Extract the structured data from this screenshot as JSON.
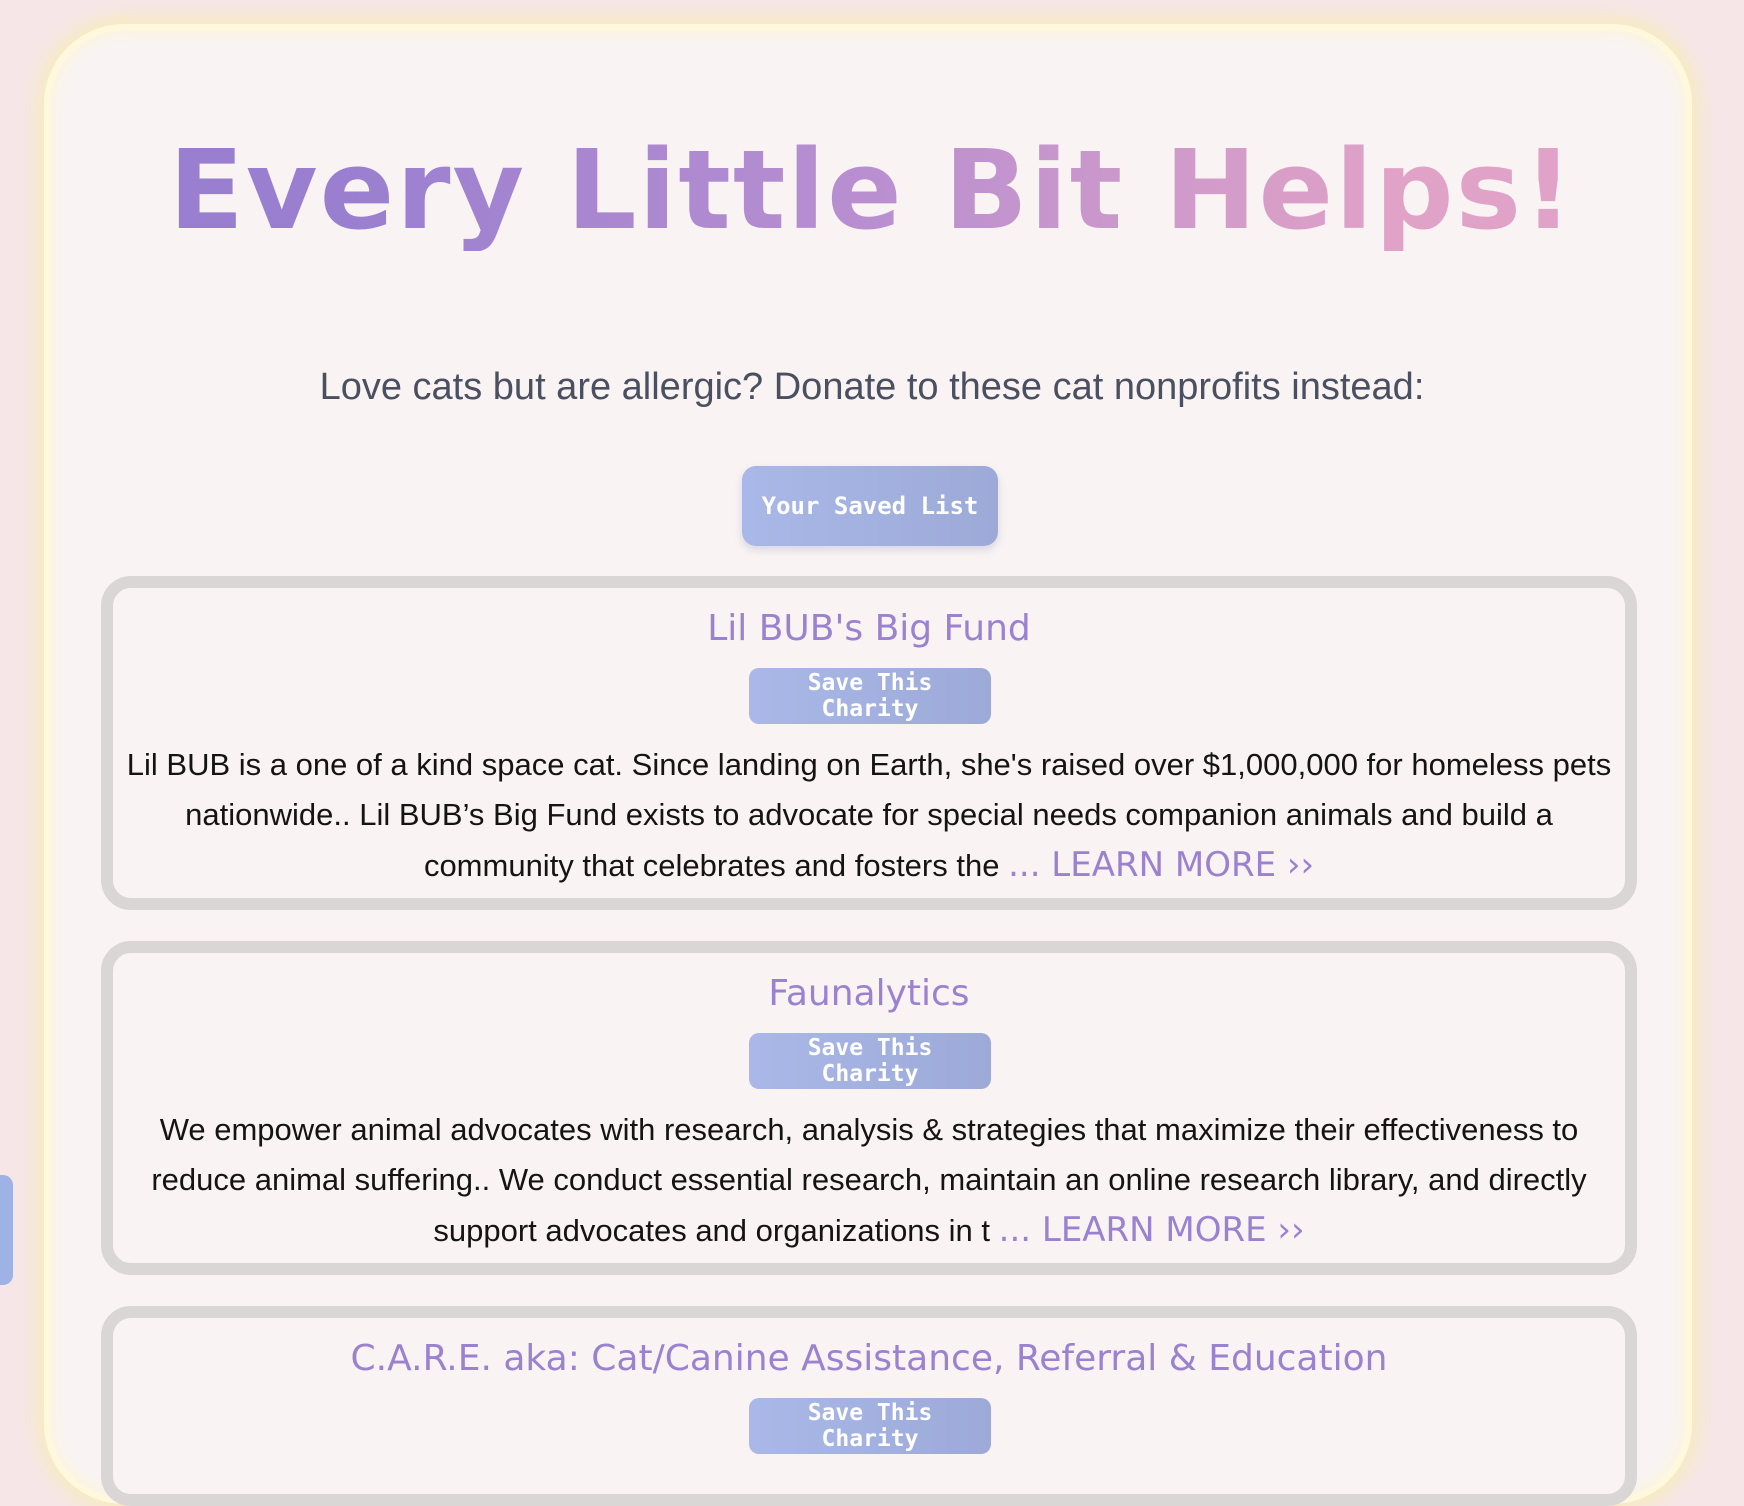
{
  "header": {
    "title": "Every Little Bit Helps!",
    "subtitle": "Love cats but are allergic? Donate to these cat nonprofits instead:",
    "saved_list_label": "Your Saved List"
  },
  "charities": [
    {
      "name": "Lil BUB's Big Fund",
      "save_label": "Save This Charity",
      "description": "Lil BUB is a one of a kind space cat. Since landing on Earth, she's raised over $1,000,000 for homeless pets nationwide.. Lil BUB’s Big Fund exists to advocate for special needs companion animals and build a community that celebrates and fosters the",
      "learn_more": "... LEARN MORE ››"
    },
    {
      "name": "Faunalytics",
      "save_label": "Save This Charity",
      "description": "We empower animal advocates with research, analysis & strategies that maximize their effectiveness to reduce animal suffering.. We conduct essential research, maintain an online research library, and directly support advocates and organizations in t",
      "learn_more": "... LEARN MORE ››"
    },
    {
      "name": "C.A.R.E. aka: Cat/Canine Assistance, Referral & Education",
      "save_label": "Save This Charity"
    }
  ],
  "colors": {
    "accent_purple": "#9a82d0",
    "button_blue": "#a9b8e8",
    "title_gradient_start": "#9a7fd0",
    "title_gradient_end": "#e0a2c6",
    "page_background": "#f6e6e8",
    "card_border": "#dbd6d6"
  }
}
